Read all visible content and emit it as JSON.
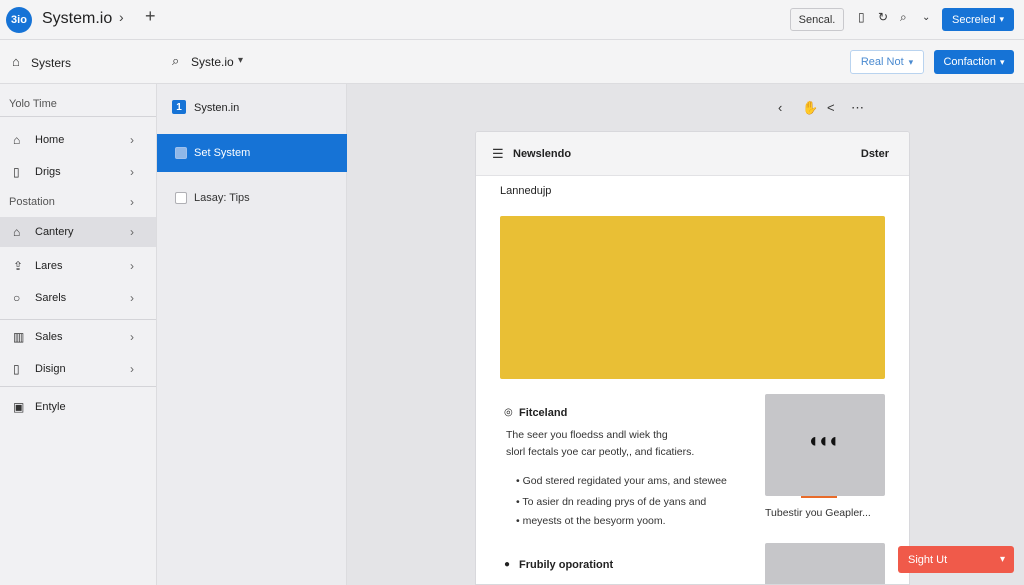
{
  "topbar": {
    "logo": "3io",
    "title": "System.io",
    "secondary_button": "Sencal.",
    "primary_button": "Secreled"
  },
  "subbar": {
    "title": "Systers",
    "search": "Syste.io",
    "outline_button": "Real Not",
    "primary_button": "Confaction"
  },
  "sidebar": {
    "heading1": "Yolo Time",
    "group1": [
      "Home",
      "Drigs"
    ],
    "heading2": "Postation",
    "group2": [
      "Cantery",
      "Lares",
      "Sarels"
    ],
    "group3": [
      "Sales",
      "Disign"
    ],
    "extra": "Entyle",
    "active_item": "Cantery"
  },
  "panel": {
    "header_badge": "1",
    "header": "Systen.in",
    "selected_item": "Set System",
    "item": "Lasay: Tips"
  },
  "card": {
    "title": "Newslendo",
    "right_label": "Dster",
    "subheading": "Lannedujp",
    "hero_color": "#e9bf35",
    "section1_title": "Fitceland",
    "section1_para": [
      "The seer you floedss andl wiek thg",
      "slorl fectals yoe car peotly,, and ficatiers."
    ],
    "bullets": [
      "God stered regidated your ams, and stewee",
      "To asier dn reading prys of de yans and",
      "meyests ot the besyorm yoom."
    ],
    "thumb_caption": "Tubestir you Geapler...",
    "section2_title": "Frubily oporationt"
  },
  "toast": {
    "label": "Sight Ut",
    "color": "#f05a4a"
  },
  "colors": {
    "accent": "#1673d6"
  }
}
